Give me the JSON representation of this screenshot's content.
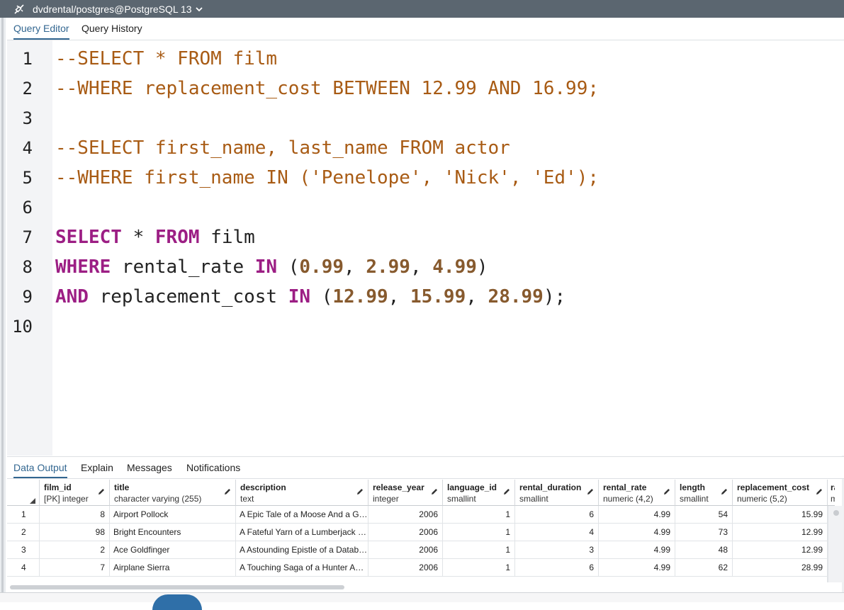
{
  "titlebar": {
    "title": "dvdrental/postgres@PostgreSQL 13"
  },
  "editor_tabs": [
    "Query Editor",
    "Query History"
  ],
  "editor": {
    "lines": [
      "1",
      "2",
      "3",
      "4",
      "5",
      "6",
      "7",
      "8",
      "9",
      "10"
    ]
  },
  "code": {
    "l1": "--SELECT * FROM film",
    "l2": "--WHERE replacement_cost BETWEEN 12.99 AND 16.99;",
    "l4": "--SELECT first_name, last_name FROM actor",
    "l5": "--WHERE first_name IN ('Penelope', 'Nick', 'Ed');",
    "l7": {
      "kw1": "SELECT",
      "p1": " * ",
      "kw2": "FROM",
      "p2": " film"
    },
    "l8": {
      "kw1": "WHERE",
      "p1": " rental_rate ",
      "kw2": "IN",
      "p2": " (",
      "n1": "0.99",
      "c1": ", ",
      "n2": "2.99",
      "c2": ", ",
      "n3": "4.99",
      "p3": ")"
    },
    "l9": {
      "kw1": "AND",
      "p1": " replacement_cost ",
      "kw2": "IN",
      "p2": " (",
      "n1": "12.99",
      "c1": ", ",
      "n2": "15.99",
      "c2": ", ",
      "n3": "28.99",
      "p3": ");"
    }
  },
  "result_tabs": [
    "Data Output",
    "Explain",
    "Messages",
    "Notifications"
  ],
  "grid": {
    "columns": [
      {
        "name": "film_id",
        "type": "[PK] integer"
      },
      {
        "name": "title",
        "type": "character varying (255)"
      },
      {
        "name": "description",
        "type": "text"
      },
      {
        "name": "release_year",
        "type": "integer"
      },
      {
        "name": "language_id",
        "type": "smallint"
      },
      {
        "name": "rental_duration",
        "type": "smallint"
      },
      {
        "name": "rental_rate",
        "type": "numeric (4,2)"
      },
      {
        "name": "length",
        "type": "smallint"
      },
      {
        "name": "replacement_cost",
        "type": "numeric (5,2)"
      },
      {
        "name": "rat",
        "type": "mp"
      }
    ],
    "rows": [
      {
        "n": "1",
        "cells": [
          "8",
          "Airport Pollock",
          "A Epic Tale of a Moose And a G…",
          "2006",
          "1",
          "6",
          "4.99",
          "54",
          "15.99"
        ]
      },
      {
        "n": "2",
        "cells": [
          "98",
          "Bright Encounters",
          "A Fateful Yarn of a Lumberjack …",
          "2006",
          "1",
          "4",
          "4.99",
          "73",
          "12.99"
        ]
      },
      {
        "n": "3",
        "cells": [
          "2",
          "Ace Goldfinger",
          "A Astounding Epistle of a Datab…",
          "2006",
          "1",
          "3",
          "4.99",
          "48",
          "12.99"
        ]
      },
      {
        "n": "4",
        "cells": [
          "7",
          "Airplane Sierra",
          "A Touching Saga of a Hunter A…",
          "2006",
          "1",
          "6",
          "4.99",
          "62",
          "28.99"
        ]
      }
    ]
  },
  "colors": {
    "titlebar": "#5b6670",
    "accent": "#326690",
    "keyword": "#9c1e84",
    "comment": "#a85b14",
    "number": "#875a2e"
  }
}
